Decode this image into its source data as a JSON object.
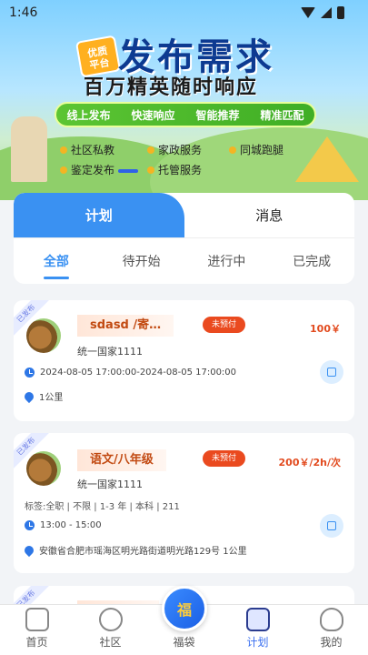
{
  "status": {
    "time": "1:46"
  },
  "banner": {
    "badge": "优质\n平台",
    "headline": "发布需求",
    "subline": "百万精英随时响应",
    "features": [
      "线上发布",
      "快速响应",
      "智能推荐",
      "精准匹配"
    ],
    "services": [
      "社区私教",
      "家政服务",
      "同城跑腿",
      "鉴定发布",
      "托管服务"
    ]
  },
  "tabs": {
    "main": [
      "计划",
      "消息"
    ],
    "sub": [
      "全部",
      "待开始",
      "进行中",
      "已完成"
    ]
  },
  "cards": [
    {
      "ribbon": "已发布",
      "title": "sdasd /寄…",
      "pay_status": "未预付",
      "price": "100￥",
      "company": "统一国家1111",
      "time": "2024-08-05 17:00:00-2024-08-05 17:00:00",
      "location": "1公里"
    },
    {
      "ribbon": "已发布",
      "title": "语文/八年级",
      "pay_status": "未预付",
      "price": "200￥/2h/次",
      "company": "统一国家1111",
      "tags": "标签:全职 | 不限 | 1-3 年 | 本科 | 211",
      "time": "13:00 - 15:00",
      "location": "安徽省合肥市瑶海区明光路街道明光路129号 1公里"
    },
    {
      "ribbon": "已发布"
    }
  ],
  "nav": {
    "items": [
      "首页",
      "社区",
      "福袋",
      "计划",
      "我的"
    ],
    "center_glyph": "福"
  }
}
